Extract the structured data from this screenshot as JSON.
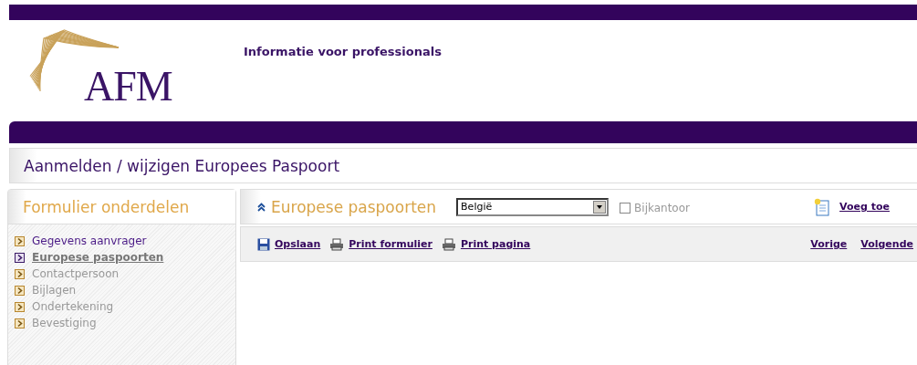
{
  "header": {
    "logo": "AFM",
    "tagline": "Informatie voor professionals"
  },
  "page_title": "Aanmelden / wijzigen Europees Paspoort",
  "sidebar": {
    "title": "Formulier onderdelen",
    "items": [
      {
        "label": "Gegevens aanvrager",
        "selected": false,
        "done": true
      },
      {
        "label": "Europese paspoorten",
        "selected": true,
        "done": false
      },
      {
        "label": "Contactpersoon",
        "selected": false,
        "done": false
      },
      {
        "label": "Bijlagen",
        "selected": false,
        "done": false
      },
      {
        "label": "Ondertekening",
        "selected": false,
        "done": false
      },
      {
        "label": "Bevestiging",
        "selected": false,
        "done": false
      }
    ]
  },
  "section": {
    "title": "Europese paspoorten",
    "country": "België",
    "branch": {
      "label": "Bijkantoor",
      "checked": false
    },
    "add": "Voeg toe"
  },
  "toolbar": {
    "actions": [
      {
        "label": "Opslaan",
        "kind": "save"
      },
      {
        "label": "Print formulier",
        "kind": "print"
      },
      {
        "label": "Print pagina",
        "kind": "print"
      }
    ],
    "nav": [
      "Vorige",
      "Volgende"
    ]
  }
}
